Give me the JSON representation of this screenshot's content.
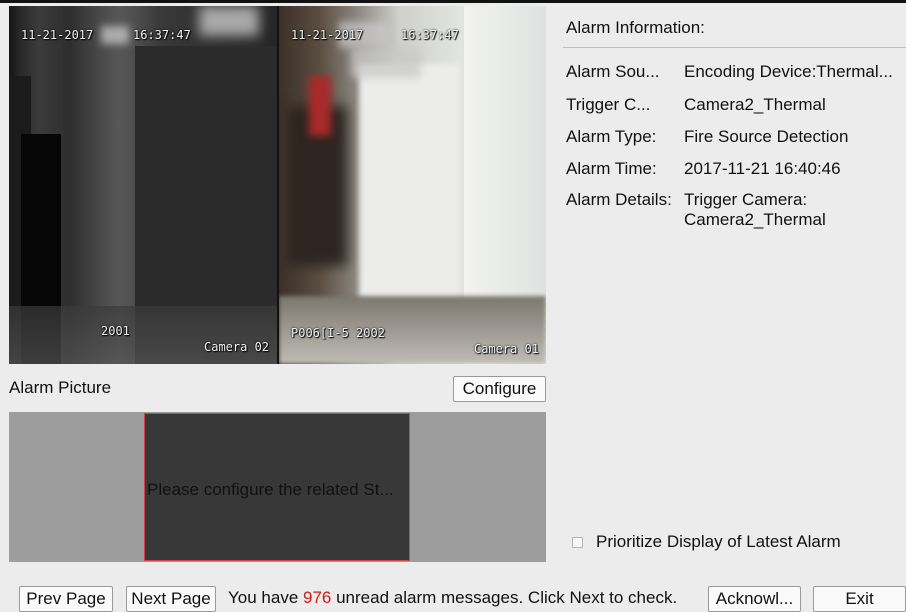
{
  "video": {
    "cam1": {
      "date": "11-21-2017",
      "time": "16:37:47",
      "id": "2001",
      "name": "Camera 02"
    },
    "cam2": {
      "date": "11-21-2017",
      "time": "16:37:47",
      "id": "P006[I-5  2002",
      "name": "Camera 01"
    }
  },
  "alarm_picture": {
    "label": "Alarm Picture",
    "configure_label": "Configure",
    "placeholder": "Please configure the related St..."
  },
  "info": {
    "title": "Alarm Information:",
    "rows": [
      {
        "key": "Alarm Sou...",
        "value": "Encoding Device:Thermal..."
      },
      {
        "key": "Trigger C...",
        "value": "Camera2_Thermal"
      },
      {
        "key": "Alarm Type:",
        "value": "Fire Source Detection"
      },
      {
        "key": "Alarm Time:",
        "value": "2017-11-21 16:40:46"
      },
      {
        "key": "Alarm Details:",
        "value": "Trigger Camera: Camera2_Thermal"
      }
    ],
    "prioritize_label": "Prioritize Display of Latest Alarm"
  },
  "footer": {
    "prev_label": "Prev Page",
    "next_label": "Next Page",
    "msg_prefix": "You have ",
    "unread_count": "976",
    "msg_suffix": " unread alarm messages. Click Next to check.",
    "ack_label": "Acknowl...",
    "exit_label": "Exit"
  },
  "colors": {
    "background": "#ececec",
    "count_red": "#d01b1b",
    "picture_border": "#cc4444"
  }
}
